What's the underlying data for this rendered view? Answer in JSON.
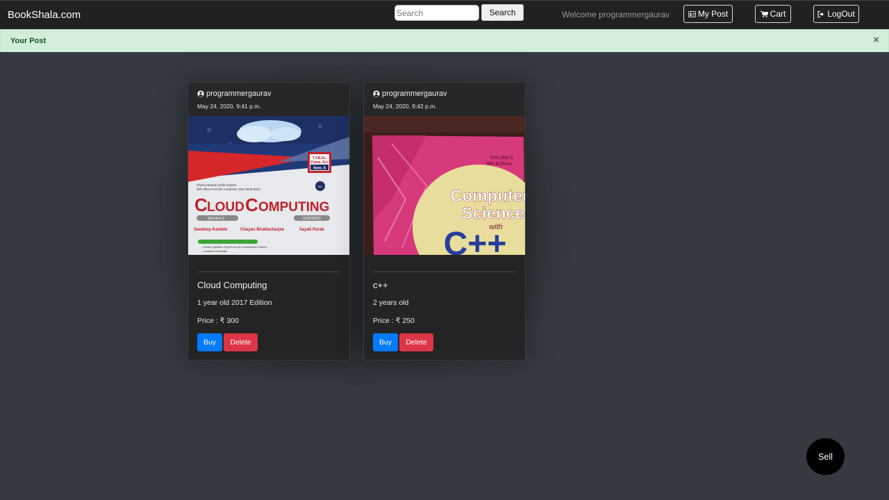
{
  "navbar": {
    "brand": "BookShala.com",
    "search_placeholder": "Search",
    "search_button": "Search",
    "welcome": "Welcome programmergaurav",
    "my_post": "My Post",
    "cart": "Cart",
    "logout": "LogOut"
  },
  "alert": {
    "text": "Your Post",
    "close": "×"
  },
  "posts": [
    {
      "author": "programmergaurav",
      "date": "May 24, 2020, 9:41 p.m.",
      "title": "Cloud Computing",
      "description": "1 year old 2017 Edition",
      "price": "Price : ₹ 300",
      "buy": "Buy",
      "delete": "Delete",
      "cover": {
        "syllabus": "Choice Based Credit System with effect from the Academic Year 2018-2019",
        "badge": "T.Y.B.Sc. Comp. Sci. Sem. 6",
        "title": "CLOUD COMPUTING",
        "subtitle": "(Elective I)",
        "code": "(USCS602)",
        "authors": [
          "Sandeep Kamble",
          "Chayan Bhattacharjee",
          "Sayali Parab"
        ]
      }
    },
    {
      "author": "programmergaurav",
      "date": "May 24, 2020, 9:42 p.m.",
      "title": "c++",
      "description": "2 years old",
      "price": "Price : ₹ 250",
      "buy": "Buy",
      "delete": "Delete",
      "cover": {
        "volume": "VOLUME II",
        "edition": "9th Edition",
        "line1": "Computer",
        "line2": "Science",
        "with": "with",
        "lang": "C++"
      }
    }
  ],
  "fab": {
    "sell": "Sell"
  },
  "colors": {
    "background": "#343a40",
    "navbar": "#212121",
    "alert_bg": "#d4edda",
    "alert_text": "#155724",
    "buy": "#007bff",
    "delete": "#dc3545"
  }
}
